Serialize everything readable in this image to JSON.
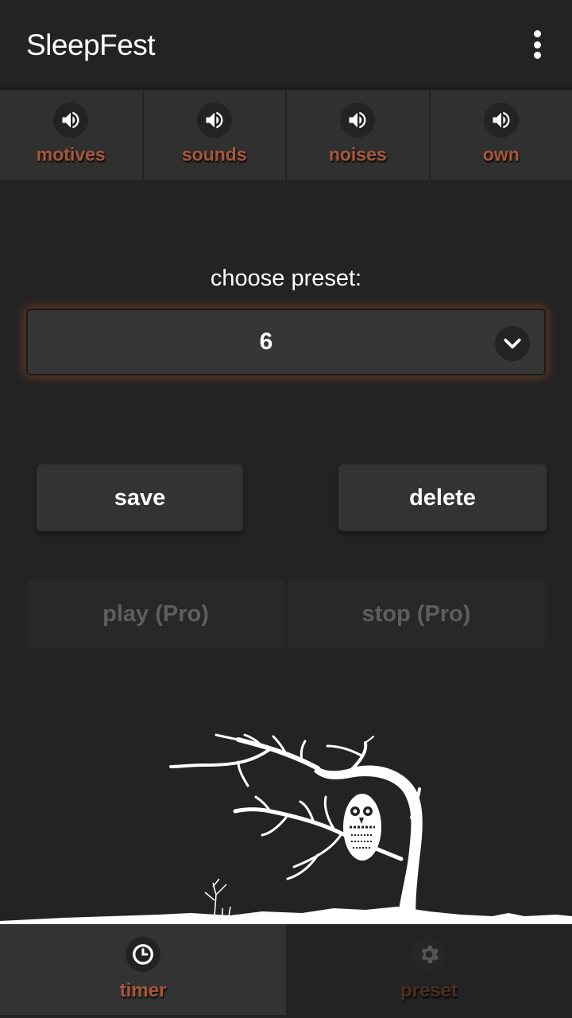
{
  "app": {
    "title": "SleepFest",
    "menu_icon": "more-vert-icon"
  },
  "top_tabs": [
    {
      "label": "motives",
      "icon": "speaker-icon"
    },
    {
      "label": "sounds",
      "icon": "speaker-icon"
    },
    {
      "label": "noises",
      "icon": "speaker-icon"
    },
    {
      "label": "own",
      "icon": "speaker-icon"
    }
  ],
  "preset": {
    "label": "choose preset:",
    "selected": "6",
    "dropdown_icon": "chevron-down-icon"
  },
  "actions": {
    "save": "save",
    "delete": "delete",
    "play": "play (Pro)",
    "stop": "stop (Pro)"
  },
  "illustration": "owl-on-tree-silhouette",
  "bottom_nav": [
    {
      "label": "timer",
      "icon": "clock-icon",
      "active": true
    },
    {
      "label": "preset",
      "icon": "gear-icon",
      "active": false
    }
  ],
  "colors": {
    "accent": "#a8573a",
    "background": "#232323",
    "surface": "#303030"
  }
}
